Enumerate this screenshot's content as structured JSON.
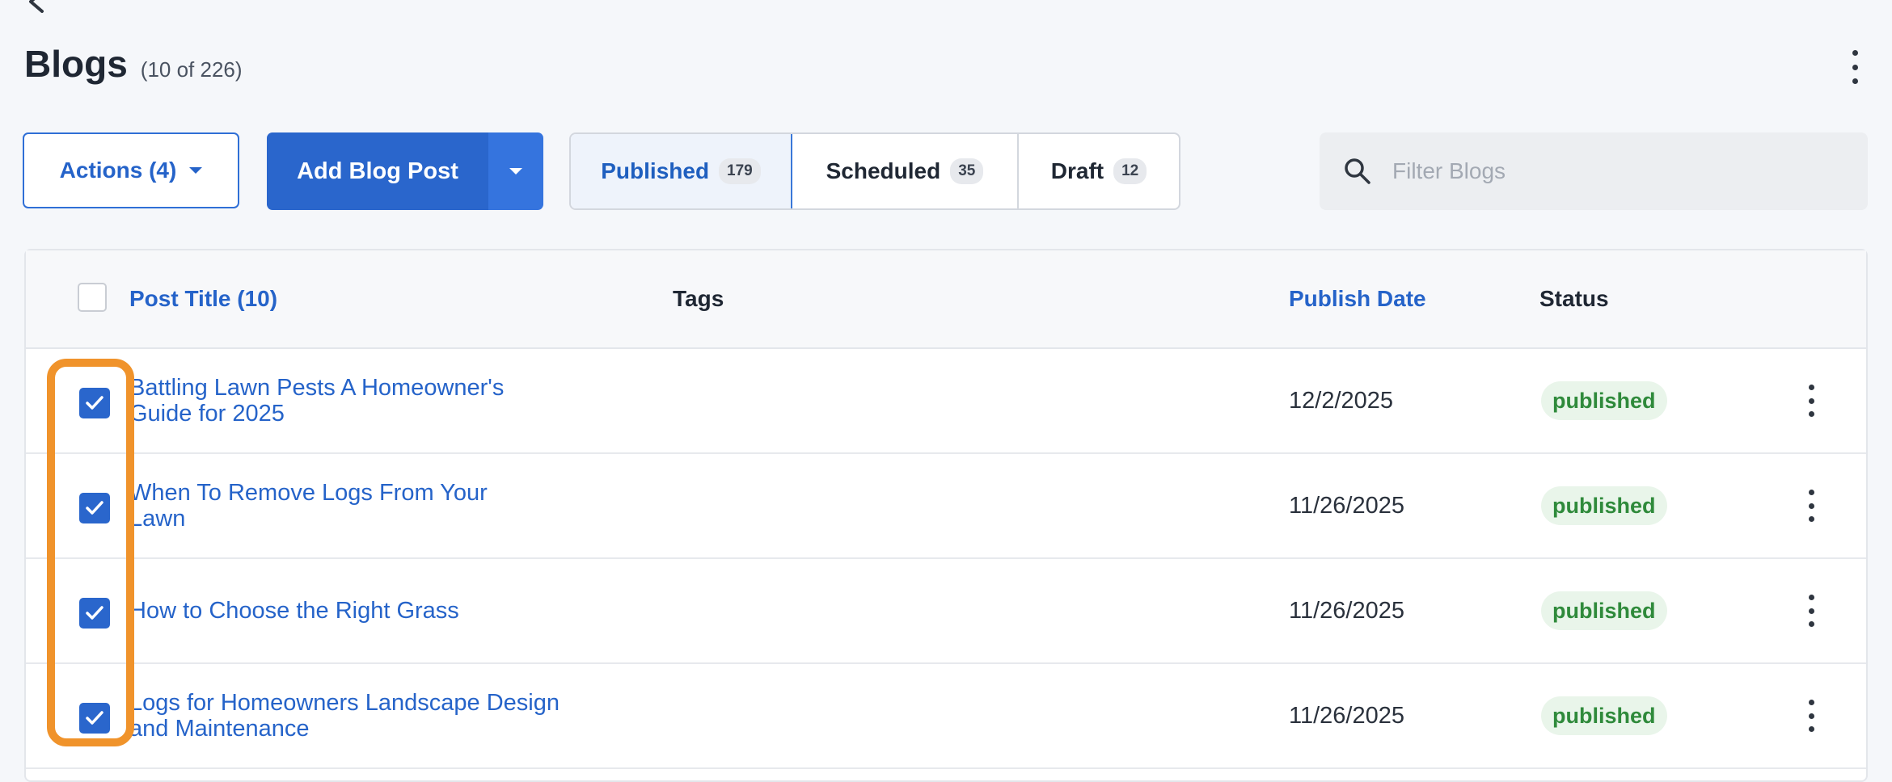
{
  "header": {
    "title": "Blogs",
    "count": "(10 of 226)"
  },
  "toolbar": {
    "actions_label": "Actions (4)",
    "add_label": "Add Blog Post"
  },
  "tabs": [
    {
      "label": "Published",
      "count": "179"
    },
    {
      "label": "Scheduled",
      "count": "35"
    },
    {
      "label": "Draft",
      "count": "12"
    }
  ],
  "search": {
    "placeholder": "Filter Blogs"
  },
  "table": {
    "columns": {
      "title": "Post Title (10)",
      "tags": "Tags",
      "date": "Publish Date",
      "status": "Status"
    },
    "rows": [
      {
        "title_line1": "Battling Lawn Pests A Homeowner's",
        "title_line2": "Guide for 2025",
        "date": "12/2/2025",
        "status": "published"
      },
      {
        "title_line1": "When To Remove Logs From Your",
        "title_line2": "Lawn",
        "date": "11/26/2025",
        "status": "published"
      },
      {
        "title_line1": "How to Choose the Right Grass",
        "title_line2": "",
        "date": "11/26/2025",
        "status": "published"
      },
      {
        "title_line1": "Logs for Homeowners Landscape Design",
        "title_line2": "and Maintenance",
        "date": "11/26/2025",
        "status": "published"
      }
    ]
  },
  "colors": {
    "primary": "#2a66cc",
    "success": "#2f8a3b",
    "highlight": "#f0932b"
  }
}
